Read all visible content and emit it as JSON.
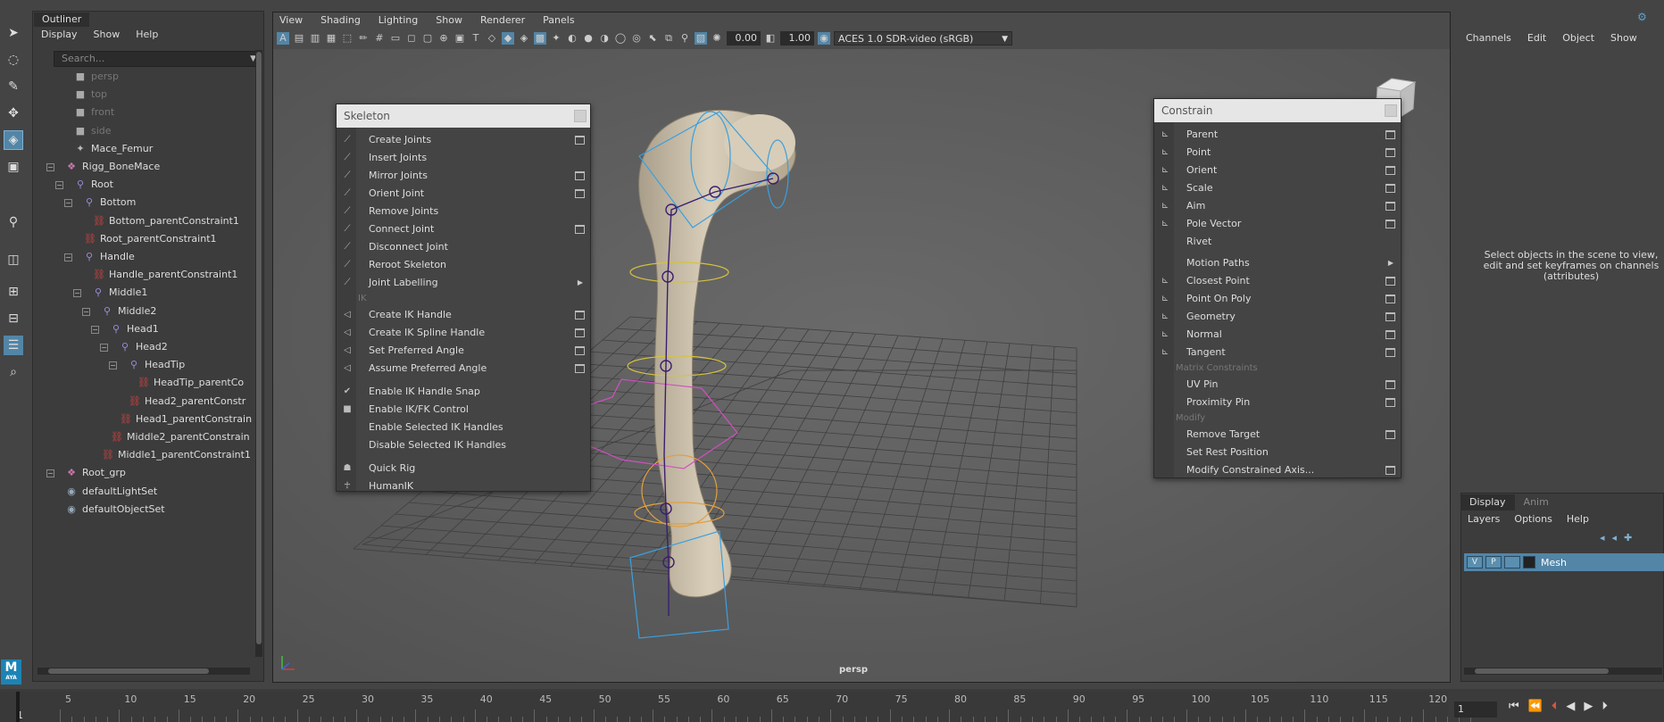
{
  "outliner": {
    "tab": "Outliner",
    "menu": [
      "Display",
      "Show",
      "Help"
    ],
    "search_placeholder": "Search...",
    "items": [
      {
        "label": "persp",
        "icon": "camera-icon",
        "dim": true
      },
      {
        "label": "top",
        "icon": "camera-icon",
        "dim": true
      },
      {
        "label": "front",
        "icon": "camera-icon",
        "dim": true
      },
      {
        "label": "side",
        "icon": "camera-icon",
        "dim": true
      },
      {
        "label": "Mace_Femur",
        "icon": "mesh-icon",
        "dim": false
      },
      {
        "label": "Rigg_BoneMace",
        "icon": "group-icon",
        "dim": false
      },
      {
        "label": "Root",
        "icon": "joint-icon",
        "dim": false
      },
      {
        "label": "Bottom",
        "icon": "joint-icon",
        "dim": false
      },
      {
        "label": "Bottom_parentConstraint1",
        "icon": "constraint-icon",
        "dim": false
      },
      {
        "label": "Root_parentConstraint1",
        "icon": "constraint-icon",
        "dim": false
      },
      {
        "label": "Handle",
        "icon": "joint-icon",
        "dim": false
      },
      {
        "label": "Handle_parentConstraint1",
        "icon": "constraint-icon",
        "dim": false
      },
      {
        "label": "Middle1",
        "icon": "joint-icon",
        "dim": false
      },
      {
        "label": "Middle2",
        "icon": "joint-icon",
        "dim": false
      },
      {
        "label": "Head1",
        "icon": "joint-icon",
        "dim": false
      },
      {
        "label": "Head2",
        "icon": "joint-icon",
        "dim": false
      },
      {
        "label": "HeadTip",
        "icon": "joint-icon",
        "dim": false
      },
      {
        "label": "HeadTip_parentCo",
        "icon": "constraint-icon",
        "dim": false
      },
      {
        "label": "Head2_parentConstr",
        "icon": "constraint-icon",
        "dim": false
      },
      {
        "label": "Head1_parentConstrain",
        "icon": "constraint-icon",
        "dim": false
      },
      {
        "label": "Middle2_parentConstrain",
        "icon": "constraint-icon",
        "dim": false
      },
      {
        "label": "Middle1_parentConstraint1",
        "icon": "constraint-icon",
        "dim": false
      },
      {
        "label": "Root_grp",
        "icon": "group-icon",
        "dim": false
      },
      {
        "label": "defaultLightSet",
        "icon": "set-icon",
        "dim": false
      },
      {
        "label": "defaultObjectSet",
        "icon": "set-icon",
        "dim": false
      }
    ]
  },
  "viewport": {
    "menu": [
      "View",
      "Shading",
      "Lighting",
      "Show",
      "Renderer",
      "Panels"
    ],
    "field1": "0.00",
    "field2": "1.00",
    "colorspace": "ACES 1.0 SDR-video (sRGB)",
    "camera_label": "persp"
  },
  "skeleton_menu": {
    "title": "Skeleton",
    "items": [
      {
        "label": "Create Joints",
        "option": true
      },
      {
        "label": "Insert Joints",
        "option": false
      },
      {
        "label": "Mirror Joints",
        "option": true
      },
      {
        "label": "Orient Joint",
        "option": true
      },
      {
        "label": "Remove Joints",
        "option": false
      },
      {
        "label": "Connect Joint",
        "option": true
      },
      {
        "label": "Disconnect Joint",
        "option": false
      },
      {
        "label": "Reroot Skeleton",
        "option": false
      },
      {
        "label": "Joint Labelling",
        "submenu": true
      }
    ],
    "ik_section": "IK",
    "ik_items": [
      {
        "label": "Create IK Handle",
        "option": true
      },
      {
        "label": "Create IK Spline Handle",
        "option": true
      },
      {
        "label": "Set Preferred Angle",
        "option": true
      },
      {
        "label": "Assume Preferred Angle",
        "option": true
      }
    ],
    "toggle_items": [
      {
        "label": "Enable IK Handle Snap",
        "checked": true
      },
      {
        "label": "Enable IK/FK Control",
        "checked": false
      },
      {
        "label": "Enable Selected IK Handles"
      },
      {
        "label": "Disable Selected IK Handles"
      }
    ],
    "rig_items": [
      "Quick Rig",
      "HumanIK"
    ]
  },
  "constrain_menu": {
    "title": "Constrain",
    "items": [
      {
        "label": "Parent",
        "option": true
      },
      {
        "label": "Point",
        "option": true
      },
      {
        "label": "Orient",
        "option": true
      },
      {
        "label": "Scale",
        "option": true
      },
      {
        "label": "Aim",
        "option": true
      },
      {
        "label": "Pole Vector",
        "option": true
      },
      {
        "label": "Rivet",
        "option": false
      }
    ],
    "items2": [
      {
        "label": "Motion Paths",
        "submenu": true
      },
      {
        "label": "Closest Point",
        "option": true
      },
      {
        "label": "Point On Poly",
        "option": true
      },
      {
        "label": "Geometry",
        "option": true
      },
      {
        "label": "Normal",
        "option": true
      },
      {
        "label": "Tangent",
        "option": true
      }
    ],
    "matrix_section": "Matrix Constraints",
    "matrix_items": [
      {
        "label": "UV Pin",
        "option": true
      },
      {
        "label": "Proximity Pin",
        "option": true
      }
    ],
    "modify_section": "Modify",
    "modify_items": [
      {
        "label": "Remove Target",
        "option": true
      },
      {
        "label": "Set Rest Position",
        "option": false
      },
      {
        "label": "Modify Constrained Axis...",
        "option": true
      }
    ]
  },
  "channel_box": {
    "menu": [
      "Channels",
      "Edit",
      "Object",
      "Show"
    ],
    "message": "Select objects in the scene to view, edit and set keyframes on channels (attributes)"
  },
  "layer_editor": {
    "tabs": [
      "Display",
      "Anim"
    ],
    "menu": [
      "Layers",
      "Options",
      "Help"
    ],
    "layer": {
      "v": "V",
      "p": "P",
      "name": "Mesh"
    }
  },
  "timeline": {
    "ticks": [
      "5",
      "10",
      "15",
      "20",
      "25",
      "30",
      "35",
      "40",
      "45",
      "50",
      "55",
      "60",
      "65",
      "70",
      "75",
      "80",
      "85",
      "90",
      "95",
      "100",
      "105",
      "110",
      "115",
      "120"
    ],
    "start_label": "1",
    "current_frame": "1"
  },
  "logo": {
    "text": "M",
    "sub": "AYA"
  },
  "colors": {
    "accent": "#5285a6",
    "bg": "#444444",
    "joint": "#9b8bd8",
    "constraint": "#d04040"
  }
}
